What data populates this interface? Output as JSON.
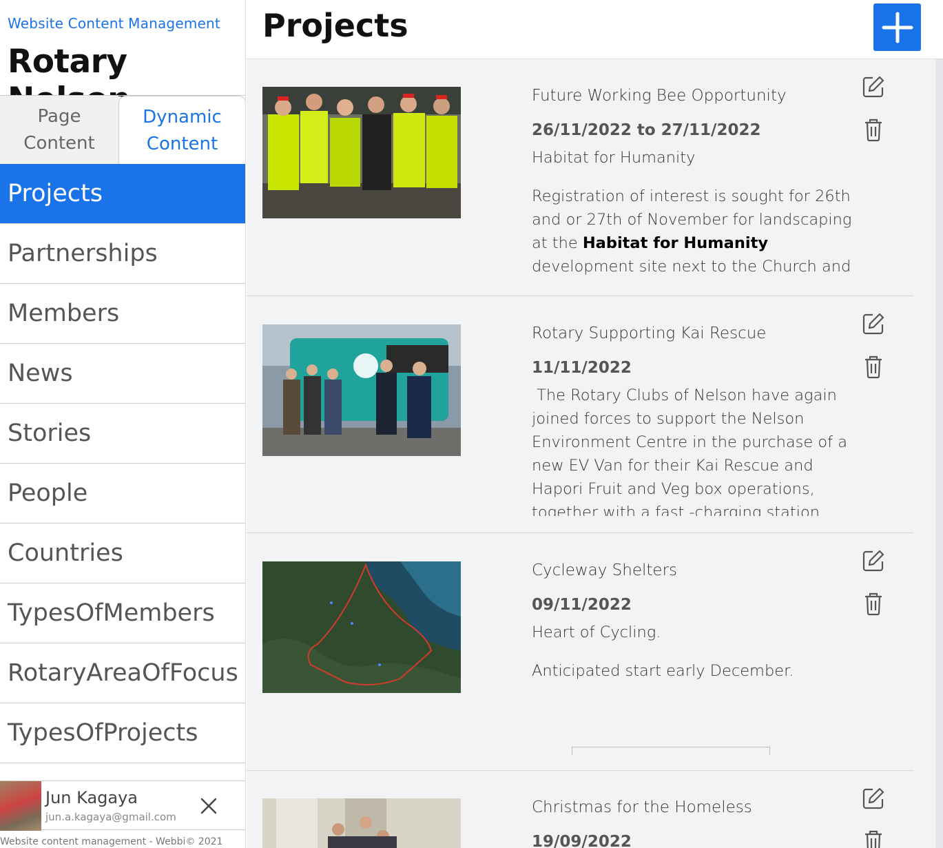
{
  "sidebar": {
    "brand_subtitle": "Website Content Management",
    "brand_title": "Rotary Nelson",
    "tabs": [
      {
        "label": "Page Content",
        "active": false
      },
      {
        "label": "Dynamic Content",
        "active": true
      }
    ],
    "nav_items": [
      {
        "label": "Projects",
        "active": true
      },
      {
        "label": "Partnerships"
      },
      {
        "label": "Members"
      },
      {
        "label": "News"
      },
      {
        "label": "Stories"
      },
      {
        "label": "People"
      },
      {
        "label": "Countries"
      },
      {
        "label": "TypesOfMembers"
      },
      {
        "label": "RotaryAreaOfFocus"
      },
      {
        "label": "TypesOfProjects"
      }
    ],
    "user": {
      "name": "Jun Kagaya",
      "email": "jun.a.kagaya@gmail.com"
    },
    "footer": "Website content management - Webbi© 2021"
  },
  "header": {
    "title": "Projects",
    "add_icon": "plus-icon"
  },
  "projects": [
    {
      "title": "Future Working Bee Opportunity",
      "date": "26/11/2022 to 27/11/2022",
      "subtitle": "Habitat for Humanity",
      "body_pre": "Registration of interest is sought for 26th and or 27th of November for landscaping at the ",
      "body_bold": "Habitat for Humanity",
      "body_post": " development site next to the Church and"
    },
    {
      "title": "Rotary Supporting Kai Rescue",
      "date": "11/11/2022",
      "body": " The Rotary Clubs of Nelson have again joined forces to support the Nelson Environment Centre in the purchase of a new EV Van for their Kai Rescue and Hapori Fruit and Veg box operations, together with a fast -charging station. The"
    },
    {
      "title": "Cycleway Shelters",
      "date": "09/11/2022",
      "subtitle": "Heart of Cycling.",
      "body": "Anticipated start early December."
    },
    {
      "title": "Christmas for the Homeless",
      "date": "19/09/2022"
    }
  ],
  "colors": {
    "accent": "#1a73e8",
    "main_bg": "#f2f3f5"
  }
}
